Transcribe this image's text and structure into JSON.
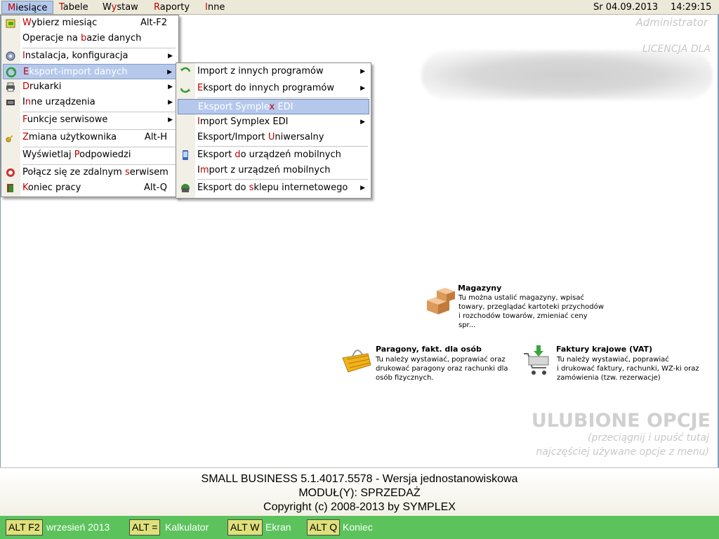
{
  "menubar": {
    "items": [
      {
        "label": "Miesiące",
        "accel": "M",
        "rest": "iesiące"
      },
      {
        "label": "Tabele",
        "accel": "T",
        "rest": "abele"
      },
      {
        "label": "Wystaw",
        "pre": "W",
        "accel": "y",
        "rest": "staw"
      },
      {
        "label": "Raporty",
        "accel": "R",
        "rest": "aporty"
      },
      {
        "label": "Inne",
        "accel": "I",
        "rest": "nne"
      }
    ],
    "date": "Sr 04.09.2013",
    "time": "14:29:15"
  },
  "user": "Administrator",
  "license_label": "LICENCJA DLA",
  "main_menu": {
    "items": [
      {
        "pre": "",
        "accel": "W",
        "rest": "ybierz miesiąc",
        "shortcut": "Alt-F2",
        "icon": "calendar-icon"
      },
      {
        "pre": "Operacje na ",
        "accel": "b",
        "rest": "azie danych",
        "shortcut": ""
      },
      {
        "pre": "",
        "accel": "I",
        "rest": "nstalacja, konfiguracja",
        "icon": "gear-icon"
      },
      {
        "pre": "",
        "accel": "E",
        "rest": "ksport-import danych",
        "icon": "refresh-icon"
      },
      {
        "pre": "",
        "accel": "D",
        "rest": "rukarki",
        "icon": "printer-icon"
      },
      {
        "pre": "I",
        "accel": "n",
        "rest": "ne urządzenia",
        "icon": "device-icon"
      },
      {
        "pre": "",
        "accel": "F",
        "rest": "unkcje serwisowe"
      },
      {
        "pre": "",
        "accel": "Z",
        "rest": "miana użytkownika",
        "shortcut": "Alt-H",
        "icon": "key-icon"
      },
      {
        "pre": "Wyświetlaj ",
        "accel": "P",
        "rest": "odpowiedzi"
      },
      {
        "pre": "Połącz się ze zdalnym ",
        "accel": "s",
        "rest": "erwisem",
        "icon": "support-icon"
      },
      {
        "pre": "",
        "accel": "K",
        "rest": "oniec pracy",
        "shortcut": "Alt-Q",
        "icon": "exit-icon"
      }
    ]
  },
  "sub_menu": {
    "items": [
      {
        "pre": "Import z innych programów",
        "accel": "",
        "rest": "",
        "icon": "import-icon"
      },
      {
        "pre": "",
        "accel": "E",
        "rest": "ksport do innych programów",
        "icon": "export-icon"
      },
      {
        "pre": "Eksport Symple",
        "accel": "x",
        "rest": " EDI"
      },
      {
        "pre": "",
        "accel": "I",
        "rest": "mport  Symplex EDI"
      },
      {
        "pre": "Eksport/Import ",
        "accel": "U",
        "rest": "niwersalny"
      },
      {
        "pre": "Eksport ",
        "accel": "d",
        "rest": "o urządzeń mobilnych",
        "icon": "mobile-icon"
      },
      {
        "pre": "I",
        "accel": "m",
        "rest": "port z urządzeń mobilnych"
      },
      {
        "pre": "Eksport do ",
        "accel": "s",
        "rest": "klepu internetowego",
        "icon": "shop-icon"
      }
    ]
  },
  "shortcuts": {
    "magazyny": {
      "title": "Magazyny",
      "desc": "Tu można ustalić magazyny, wpisać\ntowary, przeglądać kartoteki przychodów\ni rozchodów towarów, zmieniać ceny spr..."
    },
    "paragony": {
      "title": "Paragony, fakt. dla osób",
      "desc": "Tu należy wystawiać, poprawiać oraz\ndrukować paragony oraz rachunki dla\nosób fizycznych."
    },
    "faktury": {
      "title": "Faktury krajowe    (VAT)",
      "desc": "Tu należy wystawiać, poprawiać\ni drukować faktury, rachunki, WZ-ki oraz\nzamówienia (tzw. rezerwacje)"
    }
  },
  "favorites": {
    "title": "ULUBIONE OPCJE",
    "line1": "(przeciągnij i upuść tutaj",
    "line2": "najczęściej używane opcje z menu)"
  },
  "info": {
    "line1": "SMALL BUSINESS 5.1.4017.5578  - Wersja jednostanowiskowa",
    "line2": "MODUŁ(Y): SPRZEDAŻ",
    "line3": "Copyright (c) 2008-2013 by SYMPLEX"
  },
  "statusbar": {
    "items": [
      {
        "key": "ALT F2",
        "label": "wrzesień 2013"
      },
      {
        "key": "ALT =",
        "label": "Kalkulator"
      },
      {
        "key": "ALT W",
        "label": "Ekran"
      },
      {
        "key": "ALT Q",
        "label": "Koniec"
      }
    ]
  },
  "colors": {
    "accelerator": "#c00000",
    "highlight": "#b5c8ec",
    "statusbar": "#5cc35c",
    "key_bg": "#dfe07a"
  }
}
